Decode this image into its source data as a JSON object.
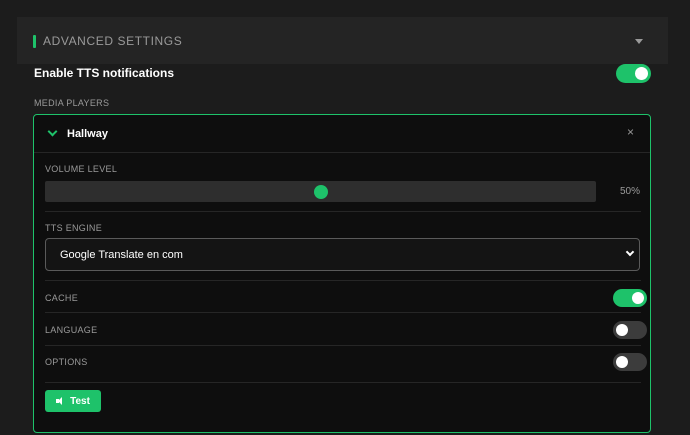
{
  "panel": {
    "title": "ADVANCED SETTINGS",
    "accent_color": "#1ec26a"
  },
  "tts_notifications": {
    "label": "Enable TTS notifications",
    "enabled": true
  },
  "media_players": {
    "section_label": "MEDIA PLAYERS",
    "players": [
      {
        "name": "Hallway",
        "expanded": true,
        "close_glyph": "×",
        "volume": {
          "label": "VOLUME LEVEL",
          "value_text": "50%",
          "value": 0.5
        },
        "tts_engine": {
          "label": "TTS ENGINE",
          "selected": "Google Translate en com"
        },
        "options": [
          {
            "label": "CACHE",
            "enabled": true
          },
          {
            "label": "LANGUAGE",
            "enabled": false
          },
          {
            "label": "OPTIONS",
            "enabled": false
          }
        ],
        "test_button": {
          "label": "Test",
          "icon": "speaker-icon"
        }
      }
    ]
  }
}
